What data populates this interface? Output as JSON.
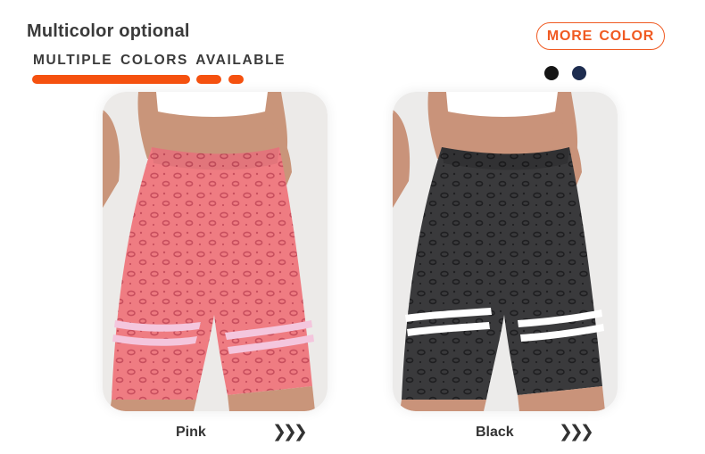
{
  "header": {
    "title": "Multicolor optional",
    "subtitle": "MULTIPLE COLORS AVAILABLE",
    "accent_color": "#f5510f"
  },
  "more_color": {
    "label": "MORE COLOR",
    "border_color": "#f05a22"
  },
  "swatches": [
    {
      "name": "black",
      "color": "#151515"
    },
    {
      "name": "navy",
      "color": "#1d2c4f"
    }
  ],
  "products": [
    {
      "label": "Pink",
      "arrows": "❯❯❯",
      "shorts_color": "#ef7c82",
      "spot_color": "#c84f5e",
      "stripe_color": "#f4c6dd",
      "background": "#eceae8",
      "skin_color": "#c9957a"
    },
    {
      "label": "Black",
      "arrows": "❯❯❯",
      "shorts_color": "#3a3a3c",
      "spot_color": "#1f1f21",
      "stripe_color": "#ffffff",
      "background": "#ecebea",
      "skin_color": "#c9937a"
    }
  ]
}
